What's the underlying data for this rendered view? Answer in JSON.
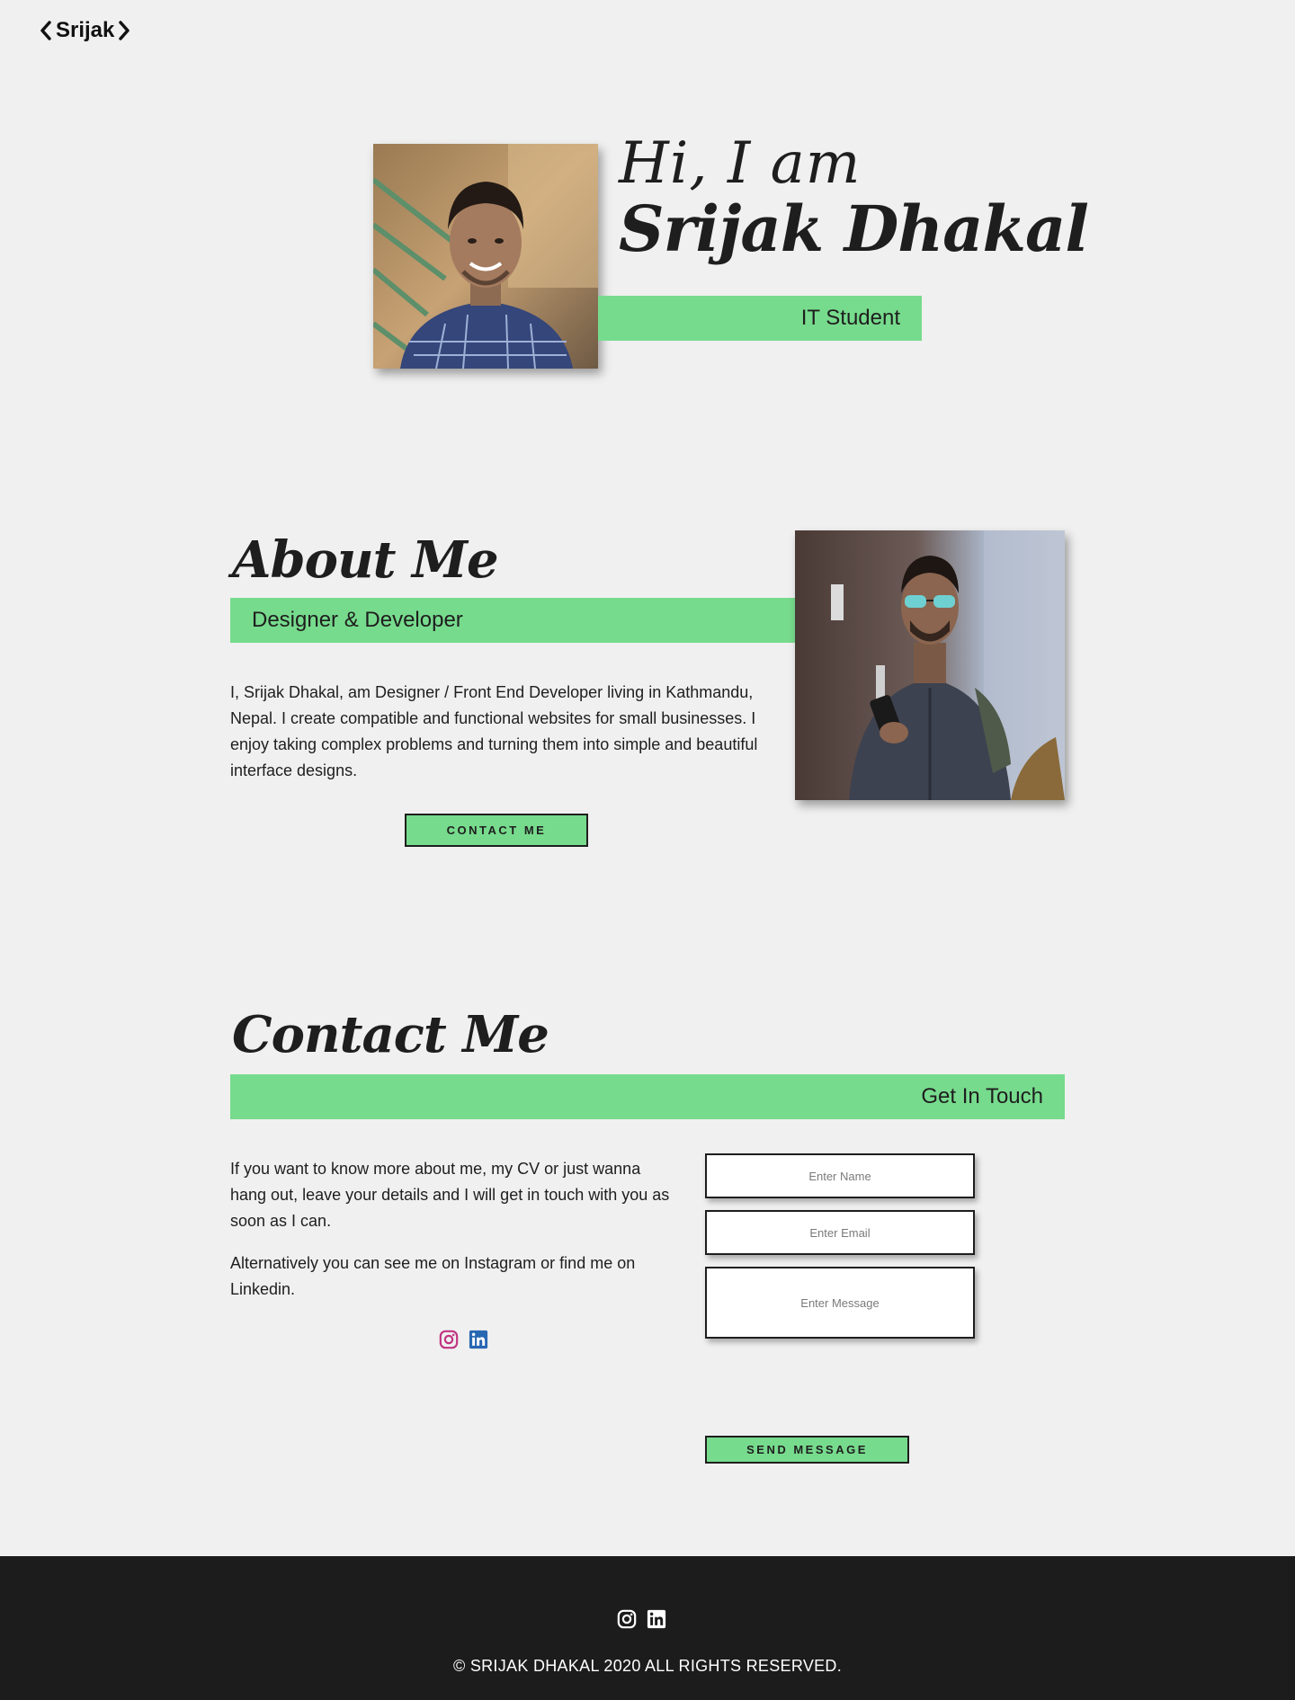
{
  "header": {
    "logo_text": "Srijak"
  },
  "hero": {
    "greeting": "Hi, I am",
    "name": "Srijak Dhakal",
    "role": "IT Student"
  },
  "about": {
    "title": "About Me",
    "subtitle": "Designer & Developer",
    "body": "I, Srijak Dhakal, am Designer / Front End Developer living in Kathmandu, Nepal. I create compatible and functional websites for small businesses. I enjoy taking complex problems and turning them into simple and beautiful interface designs.",
    "contact_button": "CONTACT ME"
  },
  "contact": {
    "title": "Contact Me",
    "subtitle": "Get In Touch",
    "paragraph1": "If you want to know more about me, my CV or just wanna hang out, leave your details and I will get in touch with you as soon as I can.",
    "paragraph2": "Alternatively you can see me on Instagram or find me on Linkedin.",
    "form": {
      "name_placeholder": "Enter Name",
      "email_placeholder": "Enter Email",
      "message_placeholder": "Enter Message",
      "send_button": "SEND MESSAGE"
    },
    "social_icons": [
      "instagram-icon",
      "linkedin-icon"
    ]
  },
  "footer": {
    "copyright": "© SRIJAK DHAKAL 2020 ALL RIGHTS RESERVED.",
    "social_icons": [
      "instagram-icon",
      "linkedin-icon"
    ]
  },
  "colors": {
    "background": "#f0f0f0",
    "accent_green": "#77db8d",
    "text": "#1e1e1e",
    "footer_bg": "#1c1c1c",
    "instagram": "#c13584",
    "linkedin": "#2867b2"
  }
}
